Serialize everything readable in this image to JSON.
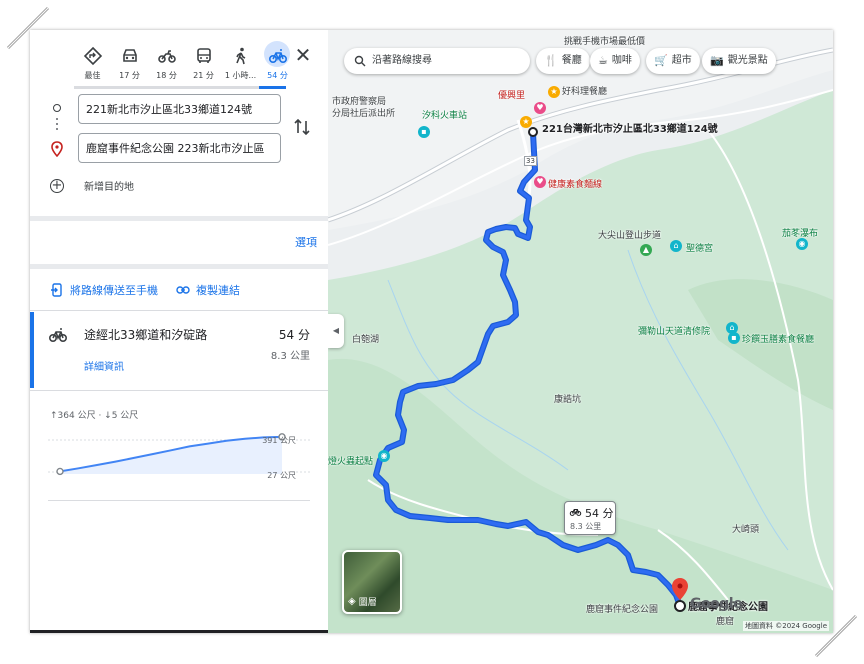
{
  "travel_modes": [
    {
      "name": "best",
      "label": "最佳",
      "icon": "diamond-turn-icon",
      "active": false
    },
    {
      "name": "drive",
      "label": "17 分",
      "icon": "car-icon",
      "active": false
    },
    {
      "name": "motorcycle",
      "label": "18 分",
      "icon": "motorcycle-icon",
      "active": false
    },
    {
      "name": "transit",
      "label": "21 分",
      "icon": "bus-icon",
      "active": false
    },
    {
      "name": "walk",
      "label": "1 小時...",
      "icon": "walk-icon",
      "active": false
    },
    {
      "name": "bike",
      "label": "54 分",
      "icon": "bicycle-icon",
      "active": true
    }
  ],
  "close_label": "✕",
  "origin": "221新北市汐止區北33鄉道124號",
  "destination": "鹿窟事件紀念公園 223新北市汐止區",
  "add_destination": "新增目的地",
  "options_label": "選項",
  "send_to_phone": "將路線傳送至手機",
  "copy_link": "複製連結",
  "route": {
    "name": "途經北33鄉道和汐碇路",
    "time": "54 分",
    "distance": "8.3 公里",
    "details": "詳細資訊"
  },
  "elevation": {
    "summary": "↑364 公尺 · ↓5 公尺",
    "max_label": "391 公尺",
    "min_label": "27 公尺",
    "profile": [
      27,
      60,
      95,
      130,
      170,
      210,
      250,
      290,
      320,
      350,
      372,
      385,
      391
    ]
  },
  "map": {
    "search_placeholder": "沿著路線搜尋",
    "chips": [
      {
        "label": "餐廳",
        "icon": "fork-knife-icon"
      },
      {
        "label": "咖啡",
        "icon": "coffee-icon"
      },
      {
        "label": "超市",
        "icon": "cart-icon"
      },
      {
        "label": "觀光景點",
        "icon": "camera-icon"
      }
    ],
    "origin_label": "221台灣新北市汐止區北33鄉道124號",
    "dest_label": "鹿窟事件紀念公園",
    "callout_time": "54 分",
    "callout_distance": "8.3 公里",
    "layers_label": "圖層",
    "google_logo": "Google",
    "attribution": "地圖資料 ©2024 Google",
    "places": [
      {
        "id": "tingshan",
        "text": "市政府警察局"
      },
      {
        "id": "tingshan2",
        "text": "分局社后派出所"
      },
      {
        "id": "xizhi_fire",
        "text": "汐科火車站"
      },
      {
        "id": "youxing",
        "text": "優興里"
      },
      {
        "id": "haoke",
        "text": "好科理餐廳"
      },
      {
        "id": "mobile_shop",
        "text": "挑戰手機市場最低價"
      },
      {
        "id": "health_noodle",
        "text": "健康素食麵線"
      },
      {
        "id": "sun_trail",
        "text": "大尖山登山步道"
      },
      {
        "id": "shengde",
        "text": "聖德宮"
      },
      {
        "id": "mile_temple",
        "text": "彌勒山天道清修院"
      },
      {
        "id": "zhenxi",
        "text": "珍饌玉膳素食餐廳"
      },
      {
        "id": "baiyun",
        "text": "白匏湖"
      },
      {
        "id": "kangshi",
        "text": "康誥坑"
      },
      {
        "id": "fire_start",
        "text": "燈火蟲起點"
      },
      {
        "id": "daqitou",
        "text": "大崎頭"
      },
      {
        "id": "luku",
        "text": "鹿窟"
      },
      {
        "id": "luku_park",
        "text": "鹿窟事件紀念公園"
      },
      {
        "id": "qiaoqin",
        "text": "茄苳瀑布"
      },
      {
        "id": "road33",
        "text": "33"
      }
    ]
  }
}
